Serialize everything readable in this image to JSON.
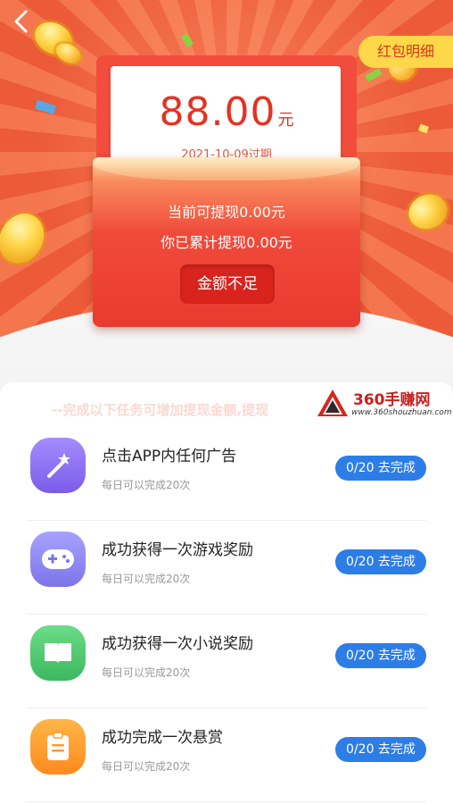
{
  "header": {
    "detail_label": "红包明细"
  },
  "redpacket": {
    "amount": "88.00",
    "amount_unit": "元",
    "expire_text": "2021-10-09过期",
    "withdrawable_text": "当前可提现0.00元",
    "total_withdrawn_text": "你已累计提现0.00元",
    "action_label": "金额不足"
  },
  "panel": {
    "hint": "--完成以下任务可增加提现金额,提现"
  },
  "watermark": {
    "title": "360手赚网",
    "url": "www.360shouzhuan.com"
  },
  "tasks": [
    {
      "title": "点击APP内任何广告",
      "subtitle": "每日可以完成20次",
      "button": "0/20 去完成",
      "icon": "magic-wand-icon",
      "color": "#8b6df2"
    },
    {
      "title": "成功获得一次游戏奖励",
      "subtitle": "每日可以完成20次",
      "button": "0/20 去完成",
      "icon": "gamepad-icon",
      "color": "#8a85f0"
    },
    {
      "title": "成功获得一次小说奖励",
      "subtitle": "每日可以完成20次",
      "button": "0/20 去完成",
      "icon": "book-icon",
      "color": "#49c36c"
    },
    {
      "title": "成功完成一次悬赏",
      "subtitle": "每日可以完成20次",
      "button": "0/20 去完成",
      "icon": "clipboard-icon",
      "color": "#ff9a2e"
    }
  ],
  "colors": {
    "accent_blue": "#2d7de6",
    "amount_red": "#e43321",
    "hero_orange": "#ef5a37"
  }
}
